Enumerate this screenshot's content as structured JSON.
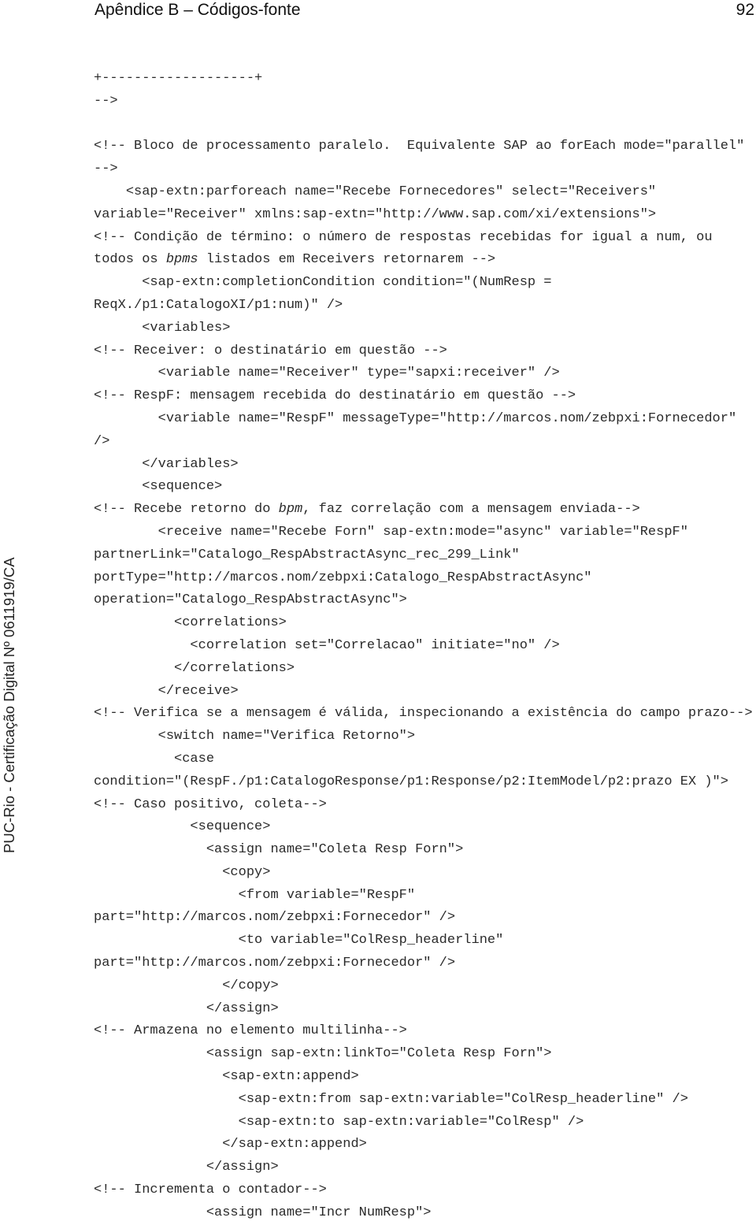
{
  "header": {
    "title": "Apêndice B – Códigos-fonte",
    "page_number": "92"
  },
  "watermark": "PUC-Rio - Certificação Digital Nº 0611919/CA",
  "code_lines": [
    {
      "indent": 0,
      "segments": [
        {
          "text": "+-------------------+"
        }
      ]
    },
    {
      "indent": 0,
      "segments": [
        {
          "text": "-->"
        }
      ]
    },
    {
      "indent": 0,
      "segments": [
        {
          "text": ""
        }
      ]
    },
    {
      "indent": 0,
      "segments": [
        {
          "text": "<!-- Bloco de processamento paralelo.  Equivalente SAP ao forEach mode=\"parallel\""
        }
      ]
    },
    {
      "indent": 0,
      "segments": [
        {
          "text": "-->"
        }
      ]
    },
    {
      "indent": 4,
      "segments": [
        {
          "text": "<sap-extn:parforeach name=\"Recebe Fornecedores\" select=\"Receivers\""
        }
      ]
    },
    {
      "indent": 0,
      "segments": [
        {
          "text": "variable=\"Receiver\" xmlns:sap-extn=\"http://www.sap.com/xi/extensions\">"
        }
      ]
    },
    {
      "indent": 0,
      "segments": [
        {
          "text": "<!-- Condição de término: o número de respostas recebidas for igual a num, ou"
        }
      ]
    },
    {
      "indent": 0,
      "segments": [
        {
          "text": "todos os "
        },
        {
          "text": "bpms",
          "italic": true
        },
        {
          "text": " listados em Receivers retornarem -->"
        }
      ]
    },
    {
      "indent": 6,
      "segments": [
        {
          "text": "<sap-extn:completionCondition condition=\"(NumResp ="
        }
      ]
    },
    {
      "indent": 0,
      "segments": [
        {
          "text": "ReqX./p1:CatalogoXI/p1:num)\" />"
        }
      ]
    },
    {
      "indent": 6,
      "segments": [
        {
          "text": "<variables>"
        }
      ]
    },
    {
      "indent": 0,
      "segments": [
        {
          "text": "<!-- Receiver: o destinatário em questão -->"
        }
      ]
    },
    {
      "indent": 8,
      "segments": [
        {
          "text": "<variable name=\"Receiver\" type=\"sapxi:receiver\" />"
        }
      ]
    },
    {
      "indent": 0,
      "segments": [
        {
          "text": "<!-- RespF: mensagem recebida do destinatário em questão -->"
        }
      ]
    },
    {
      "indent": 8,
      "segments": [
        {
          "text": "<variable name=\"RespF\" messageType=\"http://marcos.nom/zebpxi:Fornecedor\""
        }
      ]
    },
    {
      "indent": 0,
      "segments": [
        {
          "text": "/>"
        }
      ]
    },
    {
      "indent": 6,
      "segments": [
        {
          "text": "</variables>"
        }
      ]
    },
    {
      "indent": 6,
      "segments": [
        {
          "text": "<sequence>"
        }
      ]
    },
    {
      "indent": 0,
      "segments": [
        {
          "text": "<!-- Recebe retorno do "
        },
        {
          "text": "bpm",
          "italic": true
        },
        {
          "text": ", faz correlação com a mensagem enviada-->"
        }
      ]
    },
    {
      "indent": 8,
      "segments": [
        {
          "text": "<receive name=\"Recebe Forn\" sap-extn:mode=\"async\" variable=\"RespF\""
        }
      ]
    },
    {
      "indent": 0,
      "segments": [
        {
          "text": "partnerLink=\"Catalogo_RespAbstractAsync_rec_299_Link\""
        }
      ]
    },
    {
      "indent": 0,
      "segments": [
        {
          "text": "portType=\"http://marcos.nom/zebpxi:Catalogo_RespAbstractAsync\""
        }
      ]
    },
    {
      "indent": 0,
      "segments": [
        {
          "text": "operation=\"Catalogo_RespAbstractAsync\">"
        }
      ]
    },
    {
      "indent": 10,
      "segments": [
        {
          "text": "<correlations>"
        }
      ]
    },
    {
      "indent": 12,
      "segments": [
        {
          "text": "<correlation set=\"Correlacao\" initiate=\"no\" />"
        }
      ]
    },
    {
      "indent": 10,
      "segments": [
        {
          "text": "</correlations>"
        }
      ]
    },
    {
      "indent": 8,
      "segments": [
        {
          "text": "</receive>"
        }
      ]
    },
    {
      "indent": 0,
      "segments": [
        {
          "text": "<!-- Verifica se a mensagem é válida, inspecionando a existência do campo prazo-->"
        }
      ]
    },
    {
      "indent": 8,
      "segments": [
        {
          "text": "<switch name=\"Verifica Retorno\">"
        }
      ]
    },
    {
      "indent": 10,
      "segments": [
        {
          "text": "<case"
        }
      ]
    },
    {
      "indent": 0,
      "segments": [
        {
          "text": "condition=\"(RespF./p1:CatalogoResponse/p1:Response/p2:ItemModel/p2:prazo EX )\">"
        }
      ]
    },
    {
      "indent": 0,
      "segments": [
        {
          "text": "<!-- Caso positivo, coleta-->"
        }
      ]
    },
    {
      "indent": 12,
      "segments": [
        {
          "text": "<sequence>"
        }
      ]
    },
    {
      "indent": 14,
      "segments": [
        {
          "text": "<assign name=\"Coleta Resp Forn\">"
        }
      ]
    },
    {
      "indent": 16,
      "segments": [
        {
          "text": "<copy>"
        }
      ]
    },
    {
      "indent": 18,
      "segments": [
        {
          "text": "<from variable=\"RespF\""
        }
      ]
    },
    {
      "indent": 0,
      "segments": [
        {
          "text": "part=\"http://marcos.nom/zebpxi:Fornecedor\" />"
        }
      ]
    },
    {
      "indent": 18,
      "segments": [
        {
          "text": "<to variable=\"ColResp_headerline\""
        }
      ]
    },
    {
      "indent": 0,
      "segments": [
        {
          "text": "part=\"http://marcos.nom/zebpxi:Fornecedor\" />"
        }
      ]
    },
    {
      "indent": 16,
      "segments": [
        {
          "text": "</copy>"
        }
      ]
    },
    {
      "indent": 14,
      "segments": [
        {
          "text": "</assign>"
        }
      ]
    },
    {
      "indent": 0,
      "segments": [
        {
          "text": "<!-- Armazena no elemento multilinha-->"
        }
      ]
    },
    {
      "indent": 14,
      "segments": [
        {
          "text": "<assign sap-extn:linkTo=\"Coleta Resp Forn\">"
        }
      ]
    },
    {
      "indent": 16,
      "segments": [
        {
          "text": "<sap-extn:append>"
        }
      ]
    },
    {
      "indent": 18,
      "segments": [
        {
          "text": "<sap-extn:from sap-extn:variable=\"ColResp_headerline\" />"
        }
      ]
    },
    {
      "indent": 18,
      "segments": [
        {
          "text": "<sap-extn:to sap-extn:variable=\"ColResp\" />"
        }
      ]
    },
    {
      "indent": 16,
      "segments": [
        {
          "text": "</sap-extn:append>"
        }
      ]
    },
    {
      "indent": 14,
      "segments": [
        {
          "text": "</assign>"
        }
      ]
    },
    {
      "indent": 0,
      "segments": [
        {
          "text": "<!-- Incrementa o contador-->"
        }
      ]
    },
    {
      "indent": 14,
      "segments": [
        {
          "text": "<assign name=\"Incr NumResp\">"
        }
      ]
    }
  ]
}
